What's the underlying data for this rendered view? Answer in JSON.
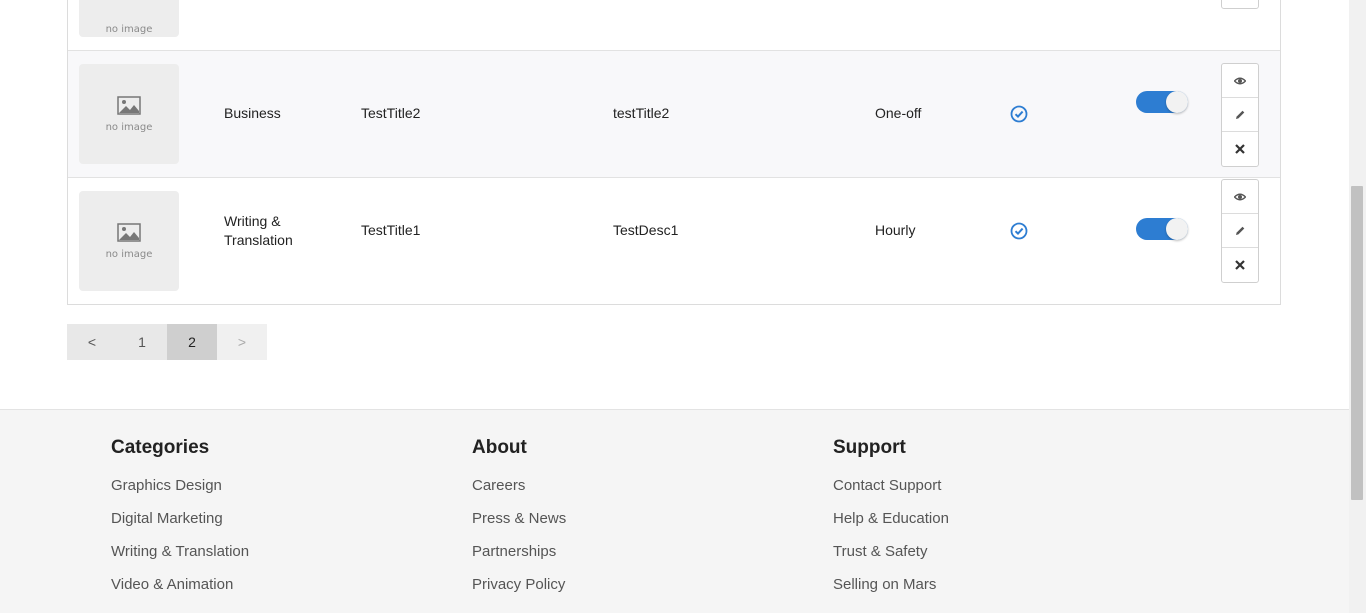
{
  "rows": [
    {
      "image_text": "no image"
    },
    {
      "image_text": "no image",
      "category": "Business",
      "title": "TestTitle2",
      "description": "testTitle2",
      "type": "One-off",
      "verified_icon": "check-circle-icon",
      "active": true
    },
    {
      "image_text": "no image",
      "category": "Writing & Translation",
      "title": "TestTitle1",
      "description": "TestDesc1",
      "type": "Hourly",
      "verified_icon": "check-circle-icon",
      "active": true
    }
  ],
  "pagination": {
    "prev": "<",
    "pages": [
      "1",
      "2"
    ],
    "current": "2",
    "next": ">"
  },
  "footer": {
    "categories": {
      "heading": "Categories",
      "links": [
        "Graphics Design",
        "Digital Marketing",
        "Writing & Translation",
        "Video & Animation"
      ]
    },
    "about": {
      "heading": "About",
      "links": [
        "Careers",
        "Press & News",
        "Partnerships",
        "Privacy Policy"
      ]
    },
    "support": {
      "heading": "Support",
      "links": [
        "Contact Support",
        "Help & Education",
        "Trust & Safety",
        "Selling on Mars"
      ]
    }
  },
  "colors": {
    "accent": "#2d7dd2",
    "footer_bg": "#f5f5f5"
  }
}
